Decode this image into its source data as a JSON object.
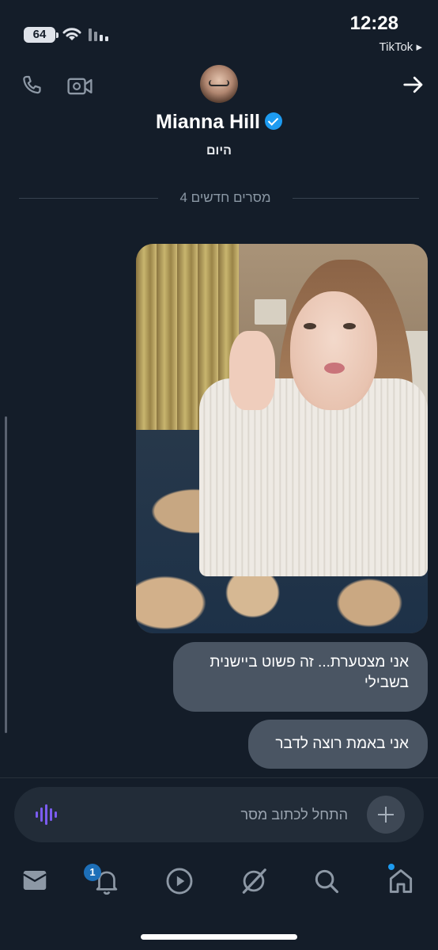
{
  "status_bar": {
    "battery_level": "64",
    "time": "12:28",
    "back_app": "TikTok ▸"
  },
  "header": {
    "contact_name": "Mianna Hill",
    "verified": true,
    "day_label": "היום"
  },
  "divider": {
    "new_messages_text": "4 מסרים חדשים"
  },
  "messages": [
    {
      "type": "image",
      "description_icon": "photo-message"
    },
    {
      "type": "text",
      "text": "אני מצטערת... זה פשוט ביישנית בשבילי"
    },
    {
      "type": "text",
      "text": "אני באמת רוצה לדבר"
    }
  ],
  "composer": {
    "placeholder": "התחל לכתוב מסר"
  },
  "bottom_nav": {
    "items": [
      "mail-icon",
      "bell-icon",
      "play-icon",
      "grok-icon",
      "search-icon",
      "home-icon"
    ],
    "notification_count": "1"
  },
  "colors": {
    "background": "#141d29",
    "bubble": "#4a5563",
    "accent": "#1d9bf0",
    "voice": "#7b5cf0"
  }
}
